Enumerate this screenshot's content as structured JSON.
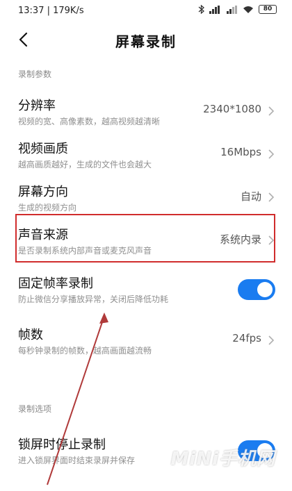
{
  "status_bar": {
    "time_speed": "13:37 | 179K/s",
    "battery": "80"
  },
  "header": {
    "title": "屏幕录制"
  },
  "sections": {
    "recording_params": "录制参数",
    "recording_options": "录制选项"
  },
  "settings": {
    "resolution": {
      "title": "分辨率",
      "subtitle": "视频的宽、高像素数，越高视频越清晰",
      "value": "2340*1080"
    },
    "quality": {
      "title": "视频画质",
      "subtitle": "越高画质越好，生成的文件也会越大",
      "value": "16Mbps"
    },
    "orientation": {
      "title": "屏幕方向",
      "subtitle": "生成的视频方向",
      "value": "自动"
    },
    "sound_source": {
      "title": "声音来源",
      "subtitle": "是否录制系统内部声音或麦克风声音",
      "value": "系统内录"
    },
    "fixed_framerate": {
      "title": "固定帧率录制",
      "subtitle": "防止微信分享播放异常，关闭后降低功耗",
      "enabled": true
    },
    "framerate": {
      "title": "帧数",
      "subtitle": "每秒钟录制的帧数，越高画面越流畅",
      "value": "24fps"
    },
    "lock_stop": {
      "title": "锁屏时停止录制",
      "subtitle": "进入锁屏界面时结束录屏并保存",
      "enabled": true
    }
  },
  "colors": {
    "accent": "#1a7cf0",
    "highlight": "#d02c2c"
  },
  "watermark": "MiNi手机网"
}
